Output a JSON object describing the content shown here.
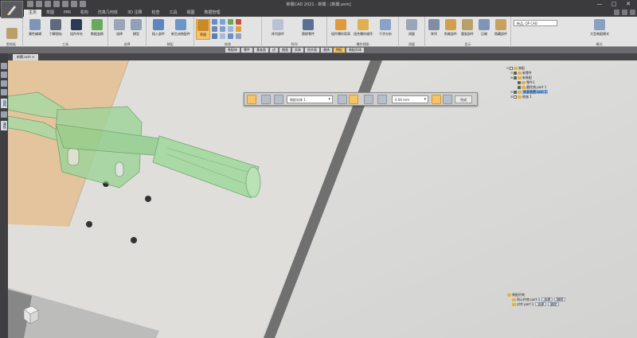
{
  "window": {
    "title": "新聞CAD 2021 - 新聞 - [新聞.asm]",
    "controls": [
      "—",
      "□",
      "✕"
    ]
  },
  "tabs": [
    {
      "label": "主页",
      "active": true
    },
    {
      "label": "草图",
      "active": false
    },
    {
      "label": "PMI",
      "active": false
    },
    {
      "label": "机构",
      "active": false
    },
    {
      "label": "仿真几何体",
      "active": false
    },
    {
      "label": "3D 注释",
      "active": false
    },
    {
      "label": "检查",
      "active": false
    },
    {
      "label": "工具",
      "active": false
    },
    {
      "label": "视图",
      "active": false
    },
    {
      "label": "数据管理",
      "active": false
    }
  ],
  "ribbon": {
    "search_placeholder": "新品, QP CAD",
    "groups": [
      {
        "label": "剪贴板",
        "buttons": [
          "剪贴板"
        ]
      },
      {
        "label": "工具",
        "buttons": [
          "属性编辑",
          "引擎图标",
          "组件命名",
          "数据变换"
        ]
      },
      {
        "label": "选择",
        "buttons": [
          "选择",
          "模型"
        ]
      },
      {
        "label": "装配",
        "buttons": [
          "插入部件",
          "新生成装配件",
          "装配"
        ]
      },
      {
        "label": "修改",
        "buttons": [
          "草图"
        ]
      },
      {
        "label": "阵列",
        "buttons": [
          "阵列部件",
          "替换零件"
        ]
      },
      {
        "label": "爆炸视图",
        "buttons": [
          "组件爆炸距离",
          "组合爆炸顺序",
          "干涉分析"
        ]
      },
      {
        "label": "测量",
        "buttons": [
          "测量"
        ]
      },
      {
        "label": "显示",
        "buttons": [
          "阵列",
          "剪裁部件",
          "重复部件",
          "压缩",
          "隐藏部件"
        ]
      },
      {
        "label": "模式",
        "buttons": [
          "大型装配模式"
        ]
      }
    ]
  },
  "strip": {
    "items": [
      {
        "label": "装配体",
        "highlight": false
      },
      {
        "label": "零件",
        "highlight": false
      },
      {
        "label": "基准面",
        "highlight": false
      },
      {
        "label": "边",
        "highlight": false
      },
      {
        "label": "曲面",
        "highlight": false
      },
      {
        "label": "实体",
        "highlight": false
      },
      {
        "label": "拓扑面",
        "highlight": false
      },
      {
        "label": "曲线",
        "highlight": false
      },
      {
        "label": "特征",
        "highlight": true
      },
      {
        "label": "装配实体",
        "highlight": false
      }
    ]
  },
  "document_tab": "新聞.asm ✕",
  "sidebar": {
    "vtabs": [
      "结构",
      "属性"
    ]
  },
  "float_toolbar": {
    "select_mode": "装配实体 1",
    "distance": "0.00 mm",
    "finish_label": "完成"
  },
  "tree": {
    "rows": [
      {
        "text": "装配",
        "indent": 0,
        "exp": "⊟",
        "check": false,
        "selected": false
      },
      {
        "text": "新零件",
        "indent": 1,
        "exp": "⊟",
        "check": true,
        "selected": false
      },
      {
        "text": "新装配",
        "indent": 1,
        "exp": "⊞",
        "check": true,
        "selected": false
      },
      {
        "text": "零件1",
        "indent": 2,
        "exp": "",
        "check": true,
        "selected": false
      },
      {
        "text": "圆柱销.part 1",
        "indent": 2,
        "exp": "",
        "check": true,
        "selected": false
      },
      {
        "text": "夹紧装置.asm 1",
        "indent": 1,
        "exp": "⊟",
        "check": true,
        "selected": true
      },
      {
        "text": "底座.1",
        "indent": 1,
        "exp": "⊞",
        "check": false,
        "selected": false
      }
    ]
  },
  "subtree": {
    "rows": [
      {
        "text": "装配约束",
        "buttons": []
      },
      {
        "text": "同心约束 part 1",
        "buttons": [
          "选择",
          "删除"
        ]
      },
      {
        "text": "对齐 part 1",
        "buttons": [
          "选择",
          "删除"
        ]
      }
    ]
  },
  "colors": {
    "accent": "#f6c467",
    "part_green": "#8ccf8a",
    "wood": "#e8c9a3",
    "plate": "#dedddb"
  }
}
